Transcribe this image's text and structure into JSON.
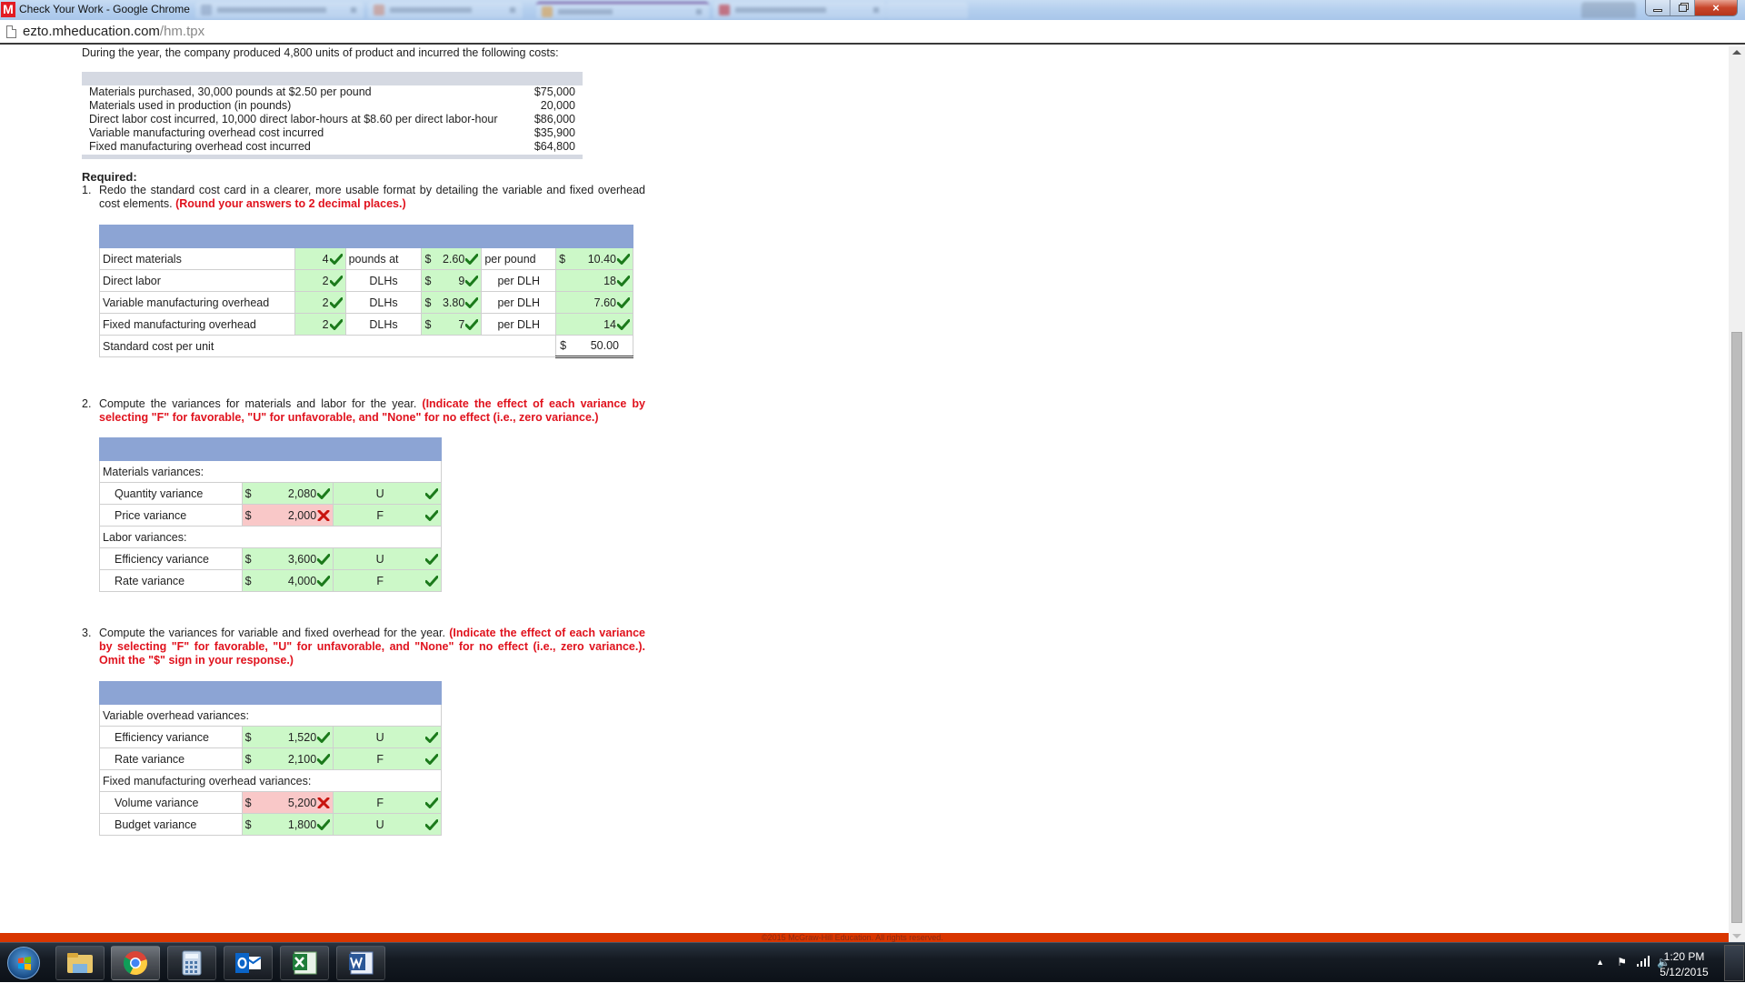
{
  "window": {
    "title": "Check Your Work - Google Chrome",
    "app_icon_letter": "M",
    "controls": {
      "minimize": "minimize",
      "maximize": "restore",
      "close": "×"
    }
  },
  "address_bar": {
    "domain": "ezto.mheducation.com",
    "path": "/hm.tpx"
  },
  "intro": "During the year, the company produced 4,800 units of product and incurred the following costs:",
  "given_costs": [
    {
      "label": "Materials purchased, 30,000 pounds at $2.50 per pound",
      "value": "$75,000"
    },
    {
      "label": "Materials used in production (in pounds)",
      "value": "20,000"
    },
    {
      "label": "Direct labor cost incurred, 10,000 direct labor-hours at $8.60 per direct labor-hour",
      "value": "$86,000"
    },
    {
      "label": "Variable manufacturing overhead cost incurred",
      "value": "$35,900"
    },
    {
      "label": "Fixed manufacturing overhead cost incurred",
      "value": "$64,800"
    }
  ],
  "required_title": "Required:",
  "q1": {
    "num": "1.",
    "text": "Redo the standard cost card in a clearer, more usable format by detailing the variable and fixed overhead cost elements.",
    "note": "(Round your answers to 2 decimal places.)",
    "rows": [
      {
        "label": "Direct materials",
        "qty": "4",
        "unit": "pounds at",
        "price_sym": "$",
        "price": "2.60",
        "per": "per pound",
        "total_sym": "$",
        "total": "10.40"
      },
      {
        "label": "Direct labor",
        "qty": "2",
        "unit": "DLHs",
        "price_sym": "$",
        "price": "9",
        "per": "per DLH",
        "total_sym": "",
        "total": "18"
      },
      {
        "label": "Variable manufacturing overhead",
        "qty": "2",
        "unit": "DLHs",
        "price_sym": "$",
        "price": "3.80",
        "per": "per DLH",
        "total_sym": "",
        "total": "7.60"
      },
      {
        "label": "Fixed manufacturing overhead",
        "qty": "2",
        "unit": "DLHs",
        "price_sym": "$",
        "price": "7",
        "per": "per DLH",
        "total_sym": "",
        "total": "14"
      }
    ],
    "total_row": {
      "label": "Standard cost per unit",
      "sym": "$",
      "value": "50.00"
    }
  },
  "q2": {
    "num": "2.",
    "text": "Compute the variances for materials and labor for the year.",
    "note": "(Indicate the effect of each variance by selecting \"F\" for favorable, \"U\" for unfavorable, and \"None\" for no effect (i.e., zero variance.)",
    "groups": [
      {
        "heading": "Materials variances:",
        "items": [
          {
            "label": "Quantity variance",
            "sym": "$",
            "amount": "2,080",
            "amount_correct": true,
            "effect": "U",
            "effect_correct": true
          },
          {
            "label": "Price variance",
            "sym": "$",
            "amount": "2,000",
            "amount_correct": false,
            "effect": "F",
            "effect_correct": true
          }
        ]
      },
      {
        "heading": "Labor variances:",
        "items": [
          {
            "label": "Efficiency variance",
            "sym": "$",
            "amount": "3,600",
            "amount_correct": true,
            "effect": "U",
            "effect_correct": true
          },
          {
            "label": "Rate variance",
            "sym": "$",
            "amount": "4,000",
            "amount_correct": true,
            "effect": "F",
            "effect_correct": true
          }
        ]
      }
    ]
  },
  "q3": {
    "num": "3.",
    "text": "Compute the variances for variable and fixed overhead for the year.",
    "note": "(Indicate the effect of each variance by selecting \"F\" for favorable, \"U\" for unfavorable, and \"None\" for no effect (i.e., zero variance.). Omit the \"$\" sign in your response.)",
    "groups": [
      {
        "heading": "Variable overhead variances:",
        "items": [
          {
            "label": "Efficiency variance",
            "sym": "$",
            "amount": "1,520",
            "amount_correct": true,
            "effect": "U",
            "effect_correct": true
          },
          {
            "label": "Rate variance",
            "sym": "$",
            "amount": "2,100",
            "amount_correct": true,
            "effect": "F",
            "effect_correct": true
          }
        ]
      },
      {
        "heading": "Fixed manufacturing overhead variances:",
        "items": [
          {
            "label": "Volume variance",
            "sym": "$",
            "amount": "5,200",
            "amount_correct": false,
            "effect": "F",
            "effect_correct": true
          },
          {
            "label": "Budget variance",
            "sym": "$",
            "amount": "1,800",
            "amount_correct": true,
            "effect": "U",
            "effect_correct": true
          }
        ]
      }
    ]
  },
  "footer": "©2015 McGraw-Hill Education. All rights reserved.",
  "colors": {
    "correct_bg": "#ccf8c8",
    "incorrect_bg": "#f9c8c8",
    "table_header": "#8ca4d4",
    "instruction_red": "#e0121d",
    "footer_bar": "#d93600",
    "check": "#1b7a1b",
    "cross": "#c8140f"
  },
  "taskbar": {
    "apps": [
      "windows-explorer",
      "google-chrome",
      "calculator",
      "outlook",
      "excel",
      "word"
    ],
    "active_app": "google-chrome",
    "tray_icons": [
      "show-hidden-icons",
      "action-center-flag",
      "network-signal",
      "volume"
    ],
    "time": "1:20 PM",
    "date": "5/12/2015"
  }
}
